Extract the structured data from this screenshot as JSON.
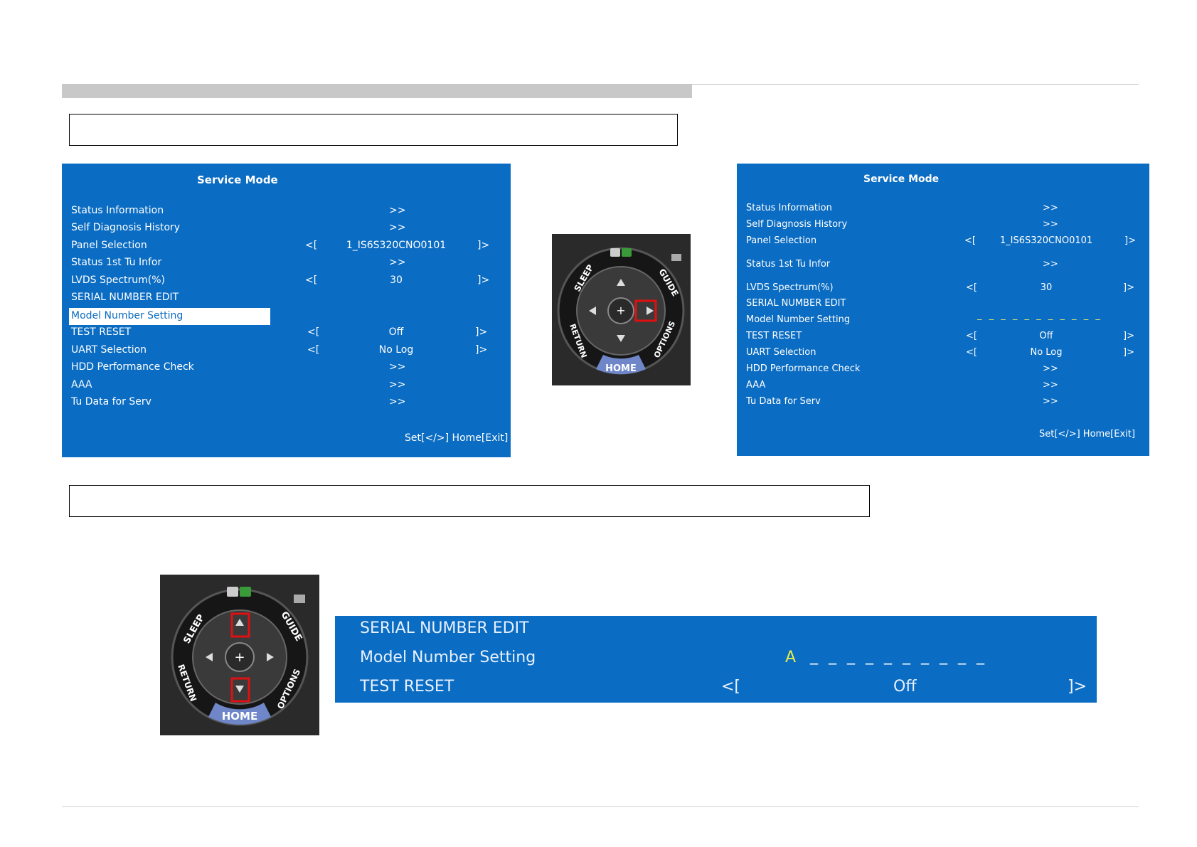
{
  "menu": {
    "title": "Service Mode",
    "rows": [
      {
        "label": "Status Information",
        "nav": ">>"
      },
      {
        "label": "Self Diagnosis History",
        "nav": ">>"
      },
      {
        "label": "Panel Selection",
        "left": "<[",
        "value": "1_IS6S320CNO0101",
        "right": "]>"
      },
      {
        "label": "Status 1st Tu Infor",
        "nav": ">>"
      },
      {
        "label": "LVDS Spectrum(%)",
        "left": "<[",
        "value": "30",
        "right": "]>"
      },
      {
        "label": "SERIAL NUMBER EDIT"
      },
      {
        "label": "Model Number Setting"
      },
      {
        "label": "TEST RESET",
        "left": "<[",
        "value": "Off",
        "right": "]>"
      },
      {
        "label": "UART Selection",
        "left": "<[",
        "value": "No Log",
        "right": "]>"
      },
      {
        "label": "HDD Performance Check",
        "nav": ">>"
      },
      {
        "label": "AAA",
        "nav": ">>"
      },
      {
        "label": "Tu Data for Serv",
        "nav": ">>"
      }
    ],
    "footer": "Set[</>] Home[Exit]",
    "model_dashes": "_ _ _ _ _ _ _ _ _ _ _"
  },
  "remote": {
    "sleep": "SLEEP",
    "guide": "GUIDE",
    "return": "RETURN",
    "options": "OPTIONS",
    "home": "HOME"
  },
  "zoom": {
    "row1": "SERIAL NUMBER EDIT",
    "row2": "Model Number Setting",
    "char": "A",
    "dashes": "_ _ _ _ _ _ _ _ _ _",
    "row3": "TEST RESET",
    "left": "<[",
    "value": "Off",
    "right": "]>"
  },
  "colors": {
    "panel": "#0a6cc2",
    "highlight_box": "#e01010",
    "cursor_char": "#e6f04a"
  }
}
